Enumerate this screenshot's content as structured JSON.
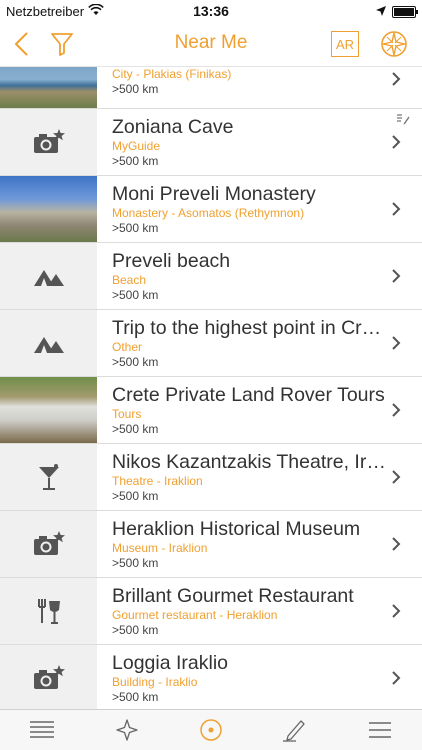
{
  "status": {
    "carrier": "Netzbetreiber",
    "time": "13:36"
  },
  "nav": {
    "title": "Near Me",
    "ar_label": "AR"
  },
  "colors": {
    "accent": "#f0a030"
  },
  "items": [
    {
      "name": "",
      "category": "City - Plakias (Finikas)",
      "distance": ">500 km",
      "thumb": "photo"
    },
    {
      "name": "Zoniana Cave",
      "category": "MyGuide",
      "distance": ">500 km",
      "thumb": "camera-star-icon"
    },
    {
      "name": "Moni Preveli Monastery",
      "category": "Monastery - Asomatos (Rethymnon)",
      "distance": ">500 km",
      "thumb": "photo"
    },
    {
      "name": "Preveli beach",
      "category": "Beach",
      "distance": ">500 km",
      "thumb": "tent-icon"
    },
    {
      "name": "Trip to the highest point in Crete",
      "category": "Other",
      "distance": ">500 km",
      "thumb": "tent-icon"
    },
    {
      "name": "Crete Private Land Rover Tours",
      "category": "Tours",
      "distance": ">500 km",
      "thumb": "photo"
    },
    {
      "name": "Nikos Kazantzakis Theatre, Iraklion",
      "category": "Theatre - Iraklion",
      "distance": ">500 km",
      "thumb": "cocktail-icon"
    },
    {
      "name": "Heraklion Historical Museum",
      "category": "Museum - Iraklion",
      "distance": ">500 km",
      "thumb": "camera-star-icon"
    },
    {
      "name": "Brillant Gourmet Restaurant",
      "category": "Gourmet restaurant - Heraklion",
      "distance": ">500 km",
      "thumb": "restaurant-icon"
    },
    {
      "name": "Loggia Iraklio",
      "category": "Building - Iraklio",
      "distance": ">500 km",
      "thumb": "camera-star-icon"
    }
  ],
  "tabs": [
    {
      "icon": "list-icon"
    },
    {
      "icon": "star-icon"
    },
    {
      "icon": "near-me-icon",
      "active": true
    },
    {
      "icon": "pen-icon"
    },
    {
      "icon": "menu-icon"
    }
  ]
}
